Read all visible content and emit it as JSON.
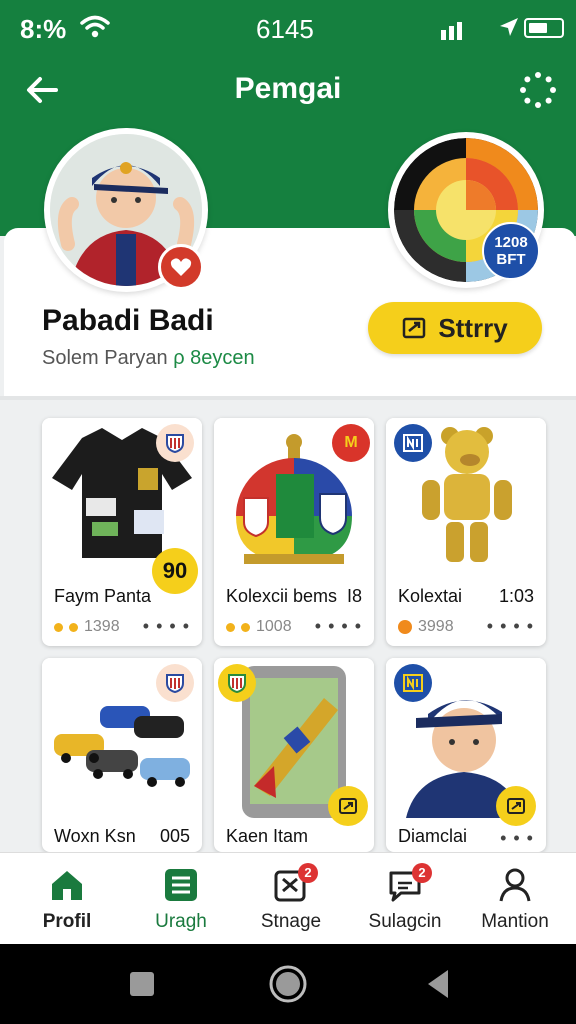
{
  "status_bar": {
    "time": "8:%",
    "center_text": "6145"
  },
  "app_bar": {
    "title": "Pemgai",
    "back_icon": "arrow-left-icon",
    "menu_icon": "loading-dots-icon"
  },
  "profile": {
    "name": "Pabadi Badi",
    "subtitle_prefix": "Solem Paryan",
    "subtitle_link": "ρ 8eycen",
    "wheel_badge_line1": "1208",
    "wheel_badge_line2": "BFT",
    "story_button": "Sttrry"
  },
  "grid": {
    "items": [
      {
        "name": "Faym Panta",
        "value": "",
        "stats": "1398",
        "price_badge": "90"
      },
      {
        "name": "Kolexcii bems",
        "value": "I8",
        "stats": "1008",
        "corner": "M"
      },
      {
        "name": "Kolextai",
        "value": "1:03",
        "stats": "3998"
      },
      {
        "name": "Woxn Ksn",
        "value": "005",
        "stats": ""
      },
      {
        "name": "Kaen Itam",
        "value": "",
        "stats": ""
      },
      {
        "name": "Diamclai",
        "value": "",
        "stats": ""
      }
    ]
  },
  "bottom_nav": {
    "items": [
      {
        "label": "Profil",
        "icon": "home-icon"
      },
      {
        "label": "Uragh",
        "icon": "list-icon"
      },
      {
        "label": "Stnage",
        "icon": "checkbox-icon",
        "badge": "2"
      },
      {
        "label": "Sulagcin",
        "icon": "chat-icon",
        "badge": "2"
      },
      {
        "label": "Mantion",
        "icon": "person-icon"
      }
    ]
  },
  "colors": {
    "brand_green": "#15803f",
    "accent_yellow": "#f5cf1b",
    "badge_red": "#d33333",
    "badge_blue": "#1e4fa8"
  }
}
